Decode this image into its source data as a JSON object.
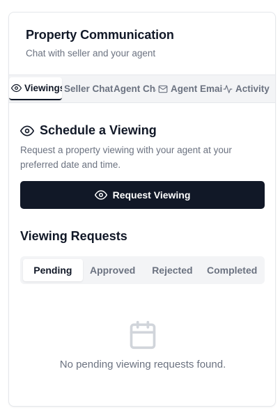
{
  "header": {
    "title": "Property Communication",
    "subtitle": "Chat with seller and your agent"
  },
  "tabs": [
    {
      "label": "Viewings",
      "icon": "eye-icon",
      "active": true
    },
    {
      "label": "Seller Chat",
      "icon": null,
      "active": false
    },
    {
      "label": "Agent Chat",
      "icon": null,
      "active": false
    },
    {
      "label": "Agent Email",
      "icon": "mail-icon",
      "active": false
    },
    {
      "label": "Activity",
      "icon": "activity-icon",
      "active": false
    }
  ],
  "schedule": {
    "title": "Schedule a Viewing",
    "description": "Request a property viewing with your agent at your preferred date and time.",
    "button_label": "Request Viewing"
  },
  "requests": {
    "title": "Viewing Requests",
    "filters": [
      {
        "label": "Pending",
        "active": true
      },
      {
        "label": "Approved",
        "active": false
      },
      {
        "label": "Rejected",
        "active": false
      },
      {
        "label": "Completed",
        "active": false
      }
    ],
    "empty_text": "No pending viewing requests found.",
    "empty_icon": "calendar-icon"
  },
  "colors": {
    "primary": "#111827",
    "muted": "#6b7280",
    "tab_bg": "#f3f4f6",
    "border": "#e5e7eb"
  }
}
